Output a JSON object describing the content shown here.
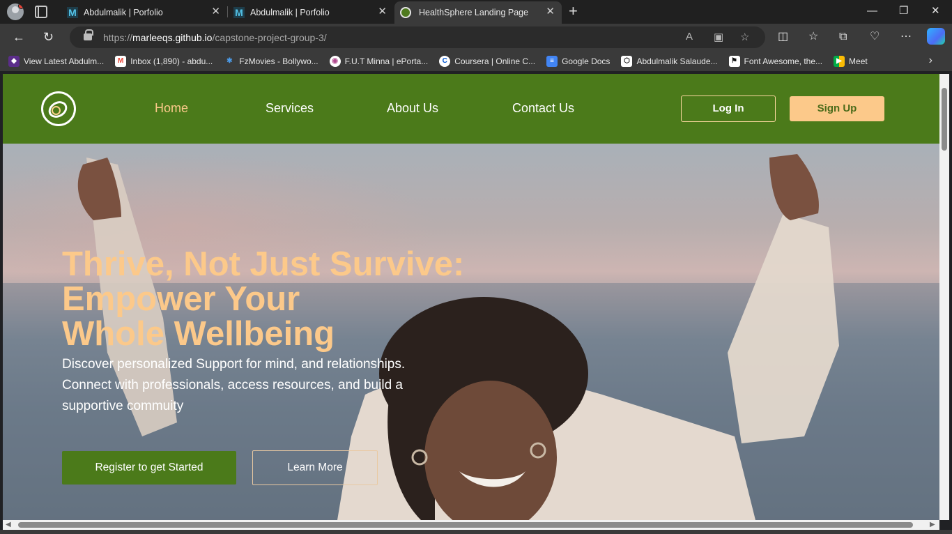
{
  "browser": {
    "tabs": [
      {
        "title": "Abdulmalik | Porfolio",
        "favicon": "m-logo-icon",
        "active": false
      },
      {
        "title": "Abdulmalik | Porfolio",
        "favicon": "m-logo-icon",
        "active": false
      },
      {
        "title": "HealthSphere Landing Page",
        "favicon": "healthsphere-logo-icon",
        "active": true
      }
    ],
    "url_prefix": "https://",
    "url_host": "marleeqs.github.io",
    "url_path": "/capstone-project-group-3/",
    "bookmarks": [
      {
        "label": "View Latest Abdulm...",
        "icon": "gem-icon",
        "color": "#6b3fa0"
      },
      {
        "label": "Inbox (1,890) - abdu...",
        "icon": "gmail-icon",
        "color": "#ea4335"
      },
      {
        "label": "FzMovies - Bollywo...",
        "icon": "palm-icon",
        "color": "#4c9be8"
      },
      {
        "label": "F.U.T Minna | ePorta...",
        "icon": "school-icon",
        "color": "#b14a8f"
      },
      {
        "label": "Coursera | Online C...",
        "icon": "coursera-icon",
        "color": "#0056d2"
      },
      {
        "label": "Google Docs",
        "icon": "docs-icon",
        "color": "#4285f4"
      },
      {
        "label": "Abdulmalik Salaude...",
        "icon": "codepen-icon",
        "color": "#ffffff"
      },
      {
        "label": "Font Awesome, the...",
        "icon": "flag-icon",
        "color": "#ffffff"
      },
      {
        "label": "Meet",
        "icon": "meet-icon",
        "color": "#00ac47"
      }
    ]
  },
  "site": {
    "nav": {
      "links": [
        "Home",
        "Services",
        "About Us",
        "Contact Us"
      ],
      "active": "Home",
      "login": "Log In",
      "signup": "Sign Up"
    },
    "hero": {
      "headline_lines": [
        "Thrive, Not Just Survive:",
        "Empower Your",
        "Whole Wellbeing"
      ],
      "subtext": "Discover personalized Support for mind, and relationships. Connect with professionals, access resources, and build a supportive commuity",
      "cta_primary": "Register to get Started",
      "cta_secondary": "Learn More"
    },
    "colors": {
      "brand_green": "#4b7a1a",
      "accent_peach": "#fcc98a"
    }
  }
}
